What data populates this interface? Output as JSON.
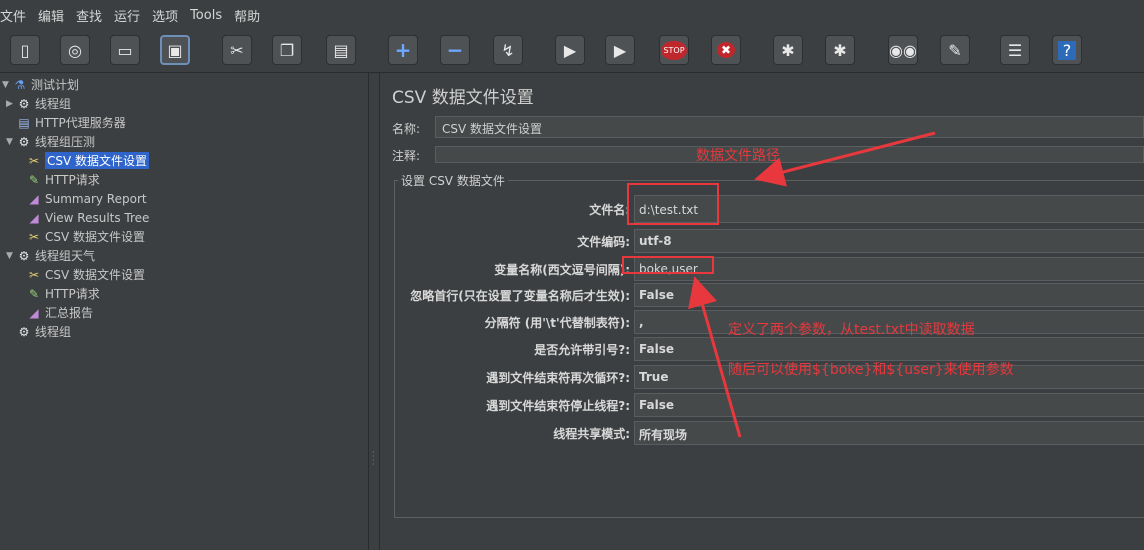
{
  "menu": [
    "文件",
    "编辑",
    "查找",
    "运行",
    "选项",
    "Tools",
    "帮助"
  ],
  "toolbar": {
    "buttons": [
      {
        "name": "new-icon",
        "glyph": "▯"
      },
      {
        "name": "templates-icon",
        "glyph": "◎"
      },
      {
        "name": "open-icon",
        "glyph": "▭"
      },
      {
        "name": "save-icon",
        "glyph": "▣"
      },
      {
        "name": "cut-icon",
        "glyph": "✂"
      },
      {
        "name": "copy-icon",
        "glyph": "❐"
      },
      {
        "name": "paste-icon",
        "glyph": "▤"
      },
      {
        "name": "expand-icon",
        "glyph": "+"
      },
      {
        "name": "collapse-icon",
        "glyph": "−"
      },
      {
        "name": "toggle-icon",
        "glyph": "↯"
      },
      {
        "name": "start-icon",
        "glyph": "▶"
      },
      {
        "name": "start-no-pause-icon",
        "glyph": "▶"
      },
      {
        "name": "stop-icon",
        "glyph": "STOP"
      },
      {
        "name": "shutdown-icon",
        "glyph": "✖"
      },
      {
        "name": "clear-icon",
        "glyph": "✱"
      },
      {
        "name": "clear-all-icon",
        "glyph": "✱"
      },
      {
        "name": "search-icon",
        "glyph": "◉◉"
      },
      {
        "name": "reset-search-icon",
        "glyph": "✎"
      },
      {
        "name": "function-helper-icon",
        "glyph": "☰"
      },
      {
        "name": "help-icon",
        "glyph": "?"
      }
    ]
  },
  "tree": [
    {
      "label": "测试计划",
      "depth": 0,
      "toggle": "▼",
      "icon": "flask-icon",
      "glyph": "⚗",
      "selected": false
    },
    {
      "label": "线程组",
      "depth": 1,
      "toggle": "▶",
      "icon": "gear-icon",
      "glyph": "⚙",
      "selected": false
    },
    {
      "label": "HTTP代理服务器",
      "depth": 1,
      "toggle": "",
      "icon": "proxy-icon",
      "glyph": "▤",
      "selected": false
    },
    {
      "label": "线程组压测",
      "depth": 1,
      "toggle": "▼",
      "icon": "gear-icon",
      "glyph": "⚙",
      "selected": false
    },
    {
      "label": "CSV 数据文件设置",
      "depth": 2,
      "toggle": "",
      "icon": "scissors-icon",
      "glyph": "✂",
      "selected": true
    },
    {
      "label": "HTTP请求",
      "depth": 2,
      "toggle": "",
      "icon": "pencil-icon",
      "glyph": "✎",
      "selected": false
    },
    {
      "label": "Summary Report",
      "depth": 2,
      "toggle": "",
      "icon": "chart-icon",
      "glyph": "◢",
      "selected": false
    },
    {
      "label": "View Results Tree",
      "depth": 2,
      "toggle": "",
      "icon": "chart-icon",
      "glyph": "◢",
      "selected": false
    },
    {
      "label": "CSV 数据文件设置",
      "depth": 2,
      "toggle": "",
      "icon": "scissors-icon",
      "glyph": "✂",
      "selected": false
    },
    {
      "label": "线程组天气",
      "depth": 1,
      "toggle": "▼",
      "icon": "gear-icon",
      "glyph": "⚙",
      "selected": false
    },
    {
      "label": "CSV 数据文件设置",
      "depth": 2,
      "toggle": "",
      "icon": "scissors-icon",
      "glyph": "✂",
      "selected": false
    },
    {
      "label": "HTTP请求",
      "depth": 2,
      "toggle": "",
      "icon": "pencil-icon",
      "glyph": "✎",
      "selected": false
    },
    {
      "label": "汇总报告",
      "depth": 2,
      "toggle": "",
      "icon": "chart-icon",
      "glyph": "◢",
      "selected": false
    },
    {
      "label": "线程组",
      "depth": 1,
      "toggle": "",
      "icon": "gear-icon",
      "glyph": "⚙",
      "selected": false
    }
  ],
  "panel": {
    "title": "CSV 数据文件设置",
    "name_label": "名称:",
    "name_value": "CSV 数据文件设置",
    "comment_label": "注释:",
    "comment_value": "",
    "group_title": "设置 CSV 数据文件",
    "rows": [
      {
        "label": "文件名:",
        "value": "d:\\test.txt"
      },
      {
        "label": "文件编码:",
        "value": "utf-8"
      },
      {
        "label": "变量名称(西文逗号间隔):",
        "value": "boke,user"
      },
      {
        "label": "忽略首行(只在设置了变量名称后才生效):",
        "value": "False"
      },
      {
        "label": "分隔符 (用'\\t'代替制表符):",
        "value": ","
      },
      {
        "label": "是否允许带引号?:",
        "value": "False"
      },
      {
        "label": "遇到文件结束符再次循环?:",
        "value": "True"
      },
      {
        "label": "遇到文件结束符停止线程?:",
        "value": "False"
      },
      {
        "label": "线程共享模式:",
        "value": "所有现场"
      }
    ]
  },
  "annotations": {
    "path": "数据文件路径",
    "params": "定义了两个参数，从test.txt中读取数据",
    "usage": "随后可以使用${boke}和${user}来使用参数",
    "color": "#e8383d"
  }
}
